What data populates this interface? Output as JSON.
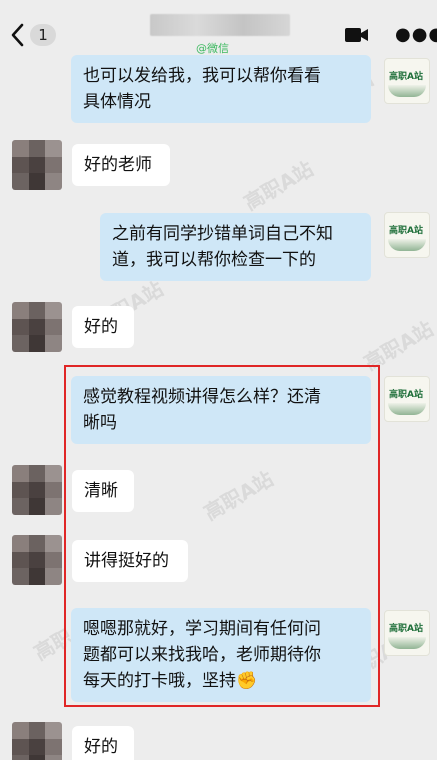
{
  "header": {
    "back_badge": "1",
    "subtitle": "@微信",
    "icons": [
      "back-chevron-icon",
      "video-call-icon",
      "more-icon"
    ]
  },
  "avatar_logo_text": "高职A站",
  "watermark_text": "高职A站",
  "messages": [
    {
      "side": "right",
      "text_lines": [
        "也可以发给我，我可以帮你看看",
        "具体情况"
      ]
    },
    {
      "side": "left",
      "text_lines": [
        "好的老师"
      ]
    },
    {
      "side": "right",
      "text_lines": [
        "之前有同学抄错单词自己不知",
        "道，我可以帮你检查一下的"
      ]
    },
    {
      "side": "left",
      "text_lines": [
        "好的"
      ]
    },
    {
      "side": "right",
      "text_lines": [
        "感觉教程视频讲得怎么样？还清",
        "晰吗"
      ]
    },
    {
      "side": "left",
      "text_lines": [
        "清晰"
      ]
    },
    {
      "side": "left",
      "text_lines": [
        "讲得挺好的"
      ]
    },
    {
      "side": "right",
      "text_lines": [
        "嗯嗯那就好，学习期间有任何问",
        "题都可以来找我哈，老师期待你",
        "每天的打卡哦，坚持✊"
      ]
    },
    {
      "side": "left",
      "text_lines": [
        "好的"
      ]
    }
  ],
  "colors": {
    "background": "#ededed",
    "right_bubble": "#cfe7f7",
    "left_bubble": "#ffffff",
    "highlight_border": "#e02626",
    "wechat_green": "#3cb95f"
  }
}
